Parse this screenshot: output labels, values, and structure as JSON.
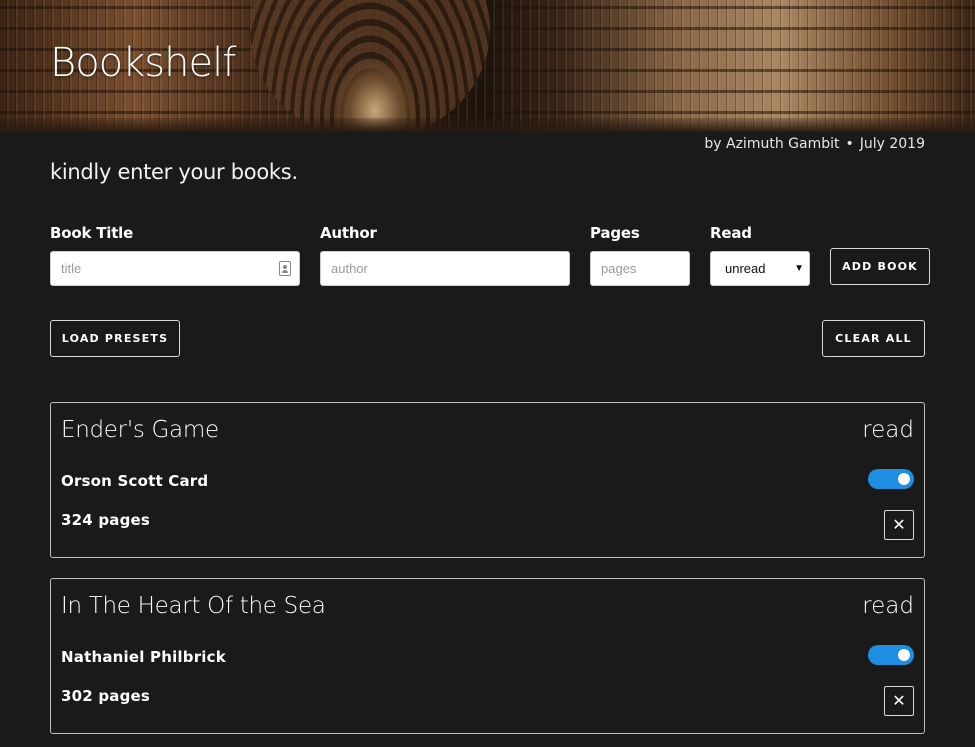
{
  "header": {
    "title": "Bookshelf",
    "byline_author": "by Azimuth Gambit",
    "byline_separator": "•",
    "byline_date": "July 2019",
    "tagline": "kindly enter your books."
  },
  "form": {
    "title_label": "Book Title",
    "title_placeholder": "title",
    "author_label": "Author",
    "author_placeholder": "author",
    "pages_label": "Pages",
    "pages_placeholder": "pages",
    "read_label": "Read",
    "read_value": "unread",
    "add_button": "ADD BOOK"
  },
  "actions": {
    "load_presets": "LOAD PRESETS",
    "clear_all": "CLEAR ALL"
  },
  "books": [
    {
      "title": "Ender's Game",
      "author": "Orson Scott Card",
      "pages": "324 pages",
      "status": "read",
      "read": true
    },
    {
      "title": "In The Heart Of the Sea",
      "author": "Nathaniel Philbrick",
      "pages": "302 pages",
      "status": "read",
      "read": true
    }
  ],
  "colors": {
    "background": "#1a1a1a",
    "toggle_on": "#1e8fe0",
    "text": "#ffffff"
  },
  "icons": {
    "remove": "close-icon",
    "contact": "contact-card-icon"
  }
}
